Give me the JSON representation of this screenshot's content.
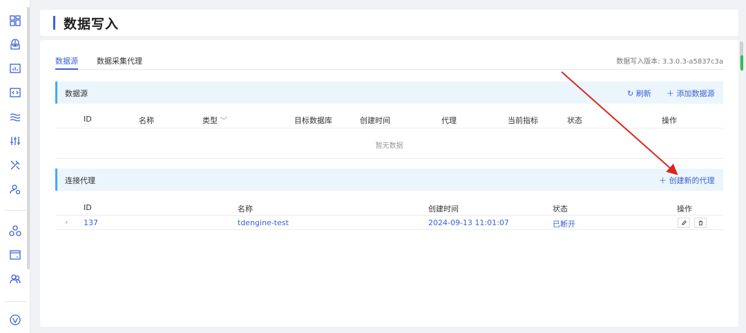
{
  "header": {
    "title": "数据写入"
  },
  "sidebar": {
    "icons": [
      "dashboard-icon",
      "data-in-icon",
      "chart-icon",
      "code-icon",
      "stream-icon",
      "cluster-icon",
      "tools-icon",
      "user-settings-icon",
      "org-icon",
      "panel-icon",
      "users-icon",
      "logo-icon"
    ]
  },
  "tabs": [
    {
      "label": "数据源",
      "active": true
    },
    {
      "label": "数据采集代理",
      "active": false
    }
  ],
  "version": "数据写入版本: 3.3.0.3-a5837c3a",
  "datasource": {
    "title": "数据源",
    "refresh_label": "刷新",
    "add_label": "添加数据源",
    "columns": [
      "ID",
      "名称",
      "类型",
      "目标数据库",
      "创建时间",
      "代理",
      "当前指标",
      "状态",
      "操作"
    ],
    "empty_text": "暂无数据"
  },
  "agents": {
    "title": "连接代理",
    "create_label": "创建新的代理",
    "columns": [
      "ID",
      "名称",
      "创建时间",
      "状态",
      "操作"
    ],
    "rows": [
      {
        "id": "137",
        "name": "tdengine-test",
        "created": "2024-09-13 11:01:07",
        "status": "已断开"
      }
    ]
  },
  "colors": {
    "accent": "#3b5fd6",
    "section_bg": "#ebf5fc",
    "arrow": "#d9261c"
  }
}
